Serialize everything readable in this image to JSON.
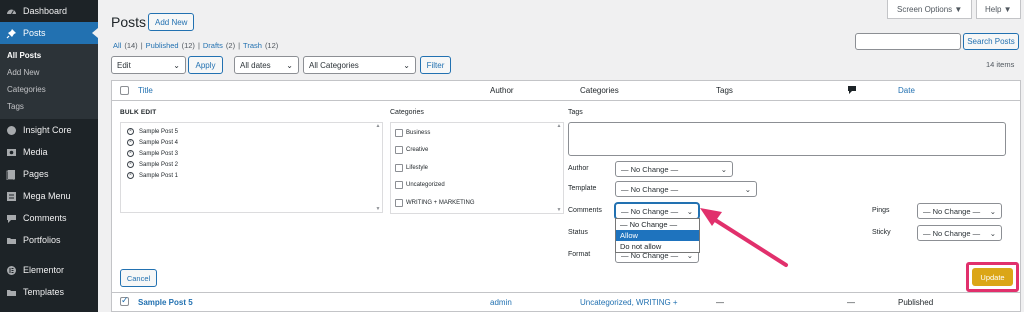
{
  "sidebar": {
    "items": [
      {
        "label": "Dashboard",
        "icon": "dashboard-icon"
      },
      {
        "label": "Posts",
        "icon": "pin-icon",
        "active": true
      },
      {
        "label": "Insight Core",
        "icon": "insight-icon"
      },
      {
        "label": "Media",
        "icon": "media-icon"
      },
      {
        "label": "Pages",
        "icon": "pages-icon"
      },
      {
        "label": "Mega Menu",
        "icon": "menu-icon"
      },
      {
        "label": "Comments",
        "icon": "comments-icon"
      },
      {
        "label": "Portfolios",
        "icon": "portfolio-icon"
      },
      {
        "label": "Elementor",
        "icon": "elementor-icon"
      },
      {
        "label": "Templates",
        "icon": "templates-icon"
      }
    ],
    "submenu": [
      "All Posts",
      "Add New",
      "Categories",
      "Tags"
    ]
  },
  "header": {
    "title": "Posts",
    "add_new": "Add New",
    "screen_options": "Screen Options ▼",
    "help": "Help ▼"
  },
  "filters": {
    "all": "All",
    "all_count": "(14)",
    "published": "Published",
    "published_count": "(12)",
    "drafts": "Drafts",
    "drafts_count": "(2)",
    "trash": "Trash",
    "trash_count": "(12)",
    "sep": "|",
    "search_button": "Search Posts",
    "bulk_action": "Edit",
    "apply": "Apply",
    "dates": "All dates",
    "categories": "All Categories",
    "filter": "Filter",
    "items_count": "14 items"
  },
  "table": {
    "columns": [
      "Title",
      "Author",
      "Categories",
      "Tags",
      "Date"
    ],
    "comments_col_icon": "comment-bubble-icon"
  },
  "bulk_edit": {
    "title": "BULK EDIT",
    "posts": [
      "Sample Post 5",
      "Sample Post 4",
      "Sample Post 3",
      "Sample Post 2",
      "Sample Post 1"
    ],
    "categories_label": "Categories",
    "categories": [
      "Business",
      "Creative",
      "Lifestyle",
      "Uncategorized",
      "WRITING + MARKETING"
    ],
    "tags_label": "Tags",
    "author_label": "Author",
    "author_value": "— No Change —",
    "template_label": "Template",
    "template_value": "— No Change —",
    "comments_label": "Comments",
    "comments_value": "— No Change —",
    "status_label": "Status",
    "format_label": "Format",
    "format_value": "— No Change —",
    "comments_options": [
      "— No Change —",
      "Allow",
      "Do not allow"
    ],
    "comments_selected": "Allow",
    "pings_label": "Pings",
    "pings_value": "— No Change —",
    "sticky_label": "Sticky",
    "sticky_value": "— No Change —",
    "cancel": "Cancel",
    "update": "Update"
  },
  "row": {
    "title": "Sample Post 5",
    "author": "admin",
    "categories": "Uncategorized, WRITING +",
    "tags": "—",
    "comments": "—",
    "date": "Published"
  },
  "colors": {
    "accent": "#2271b1",
    "sidebar": "#1d2327",
    "update": "#dba617",
    "highlight": "#e1306c"
  }
}
